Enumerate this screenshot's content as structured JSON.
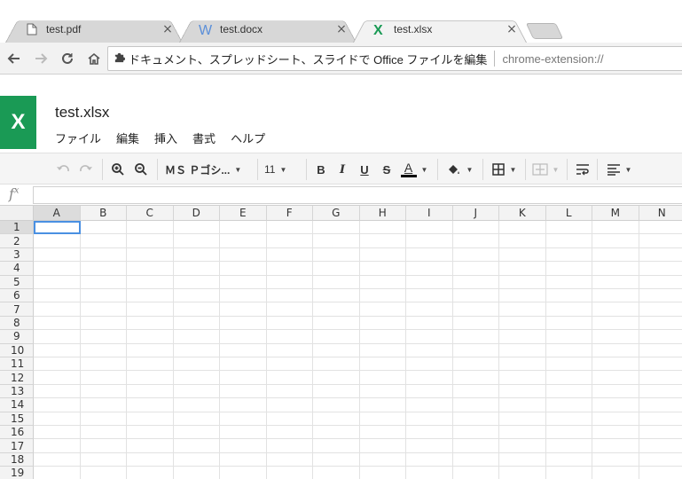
{
  "tabs": [
    {
      "title": "test.pdf",
      "icon": "document-icon",
      "active": false
    },
    {
      "title": "test.docx",
      "icon": "word-icon",
      "active": false
    },
    {
      "title": "test.xlsx",
      "icon": "excel-icon",
      "active": true
    }
  ],
  "tab_close_glyph": "×",
  "omnibox": {
    "extension_text": "ドキュメント、スプレッドシート、スライドで Office ファイルを編集",
    "url": "chrome-extension://"
  },
  "app": {
    "logo_letter": "X",
    "doc_title": "test.xlsx",
    "menu": [
      "ファイル",
      "編集",
      "挿入",
      "書式",
      "ヘルプ"
    ],
    "brand_color": "#1a9a55"
  },
  "format_toolbar": {
    "font_name": "ＭＳ Ｐゴシ...",
    "font_size": "11",
    "bold": "B",
    "italic": "I",
    "underline": "U",
    "strike": "S",
    "text_color": "A"
  },
  "formula_bar": {
    "fx_label": "f",
    "fx_sup": "x",
    "value": ""
  },
  "grid": {
    "columns": [
      "A",
      "B",
      "C",
      "D",
      "E",
      "F",
      "G",
      "H",
      "I",
      "J",
      "K",
      "L",
      "M",
      "N"
    ],
    "rows": [
      "1",
      "2",
      "3",
      "4",
      "5",
      "6",
      "7",
      "8",
      "9",
      "10",
      "11",
      "12",
      "13",
      "14",
      "15",
      "16",
      "17",
      "18",
      "19"
    ],
    "selected_cell": "A1",
    "selection_color": "#4a90e2"
  }
}
